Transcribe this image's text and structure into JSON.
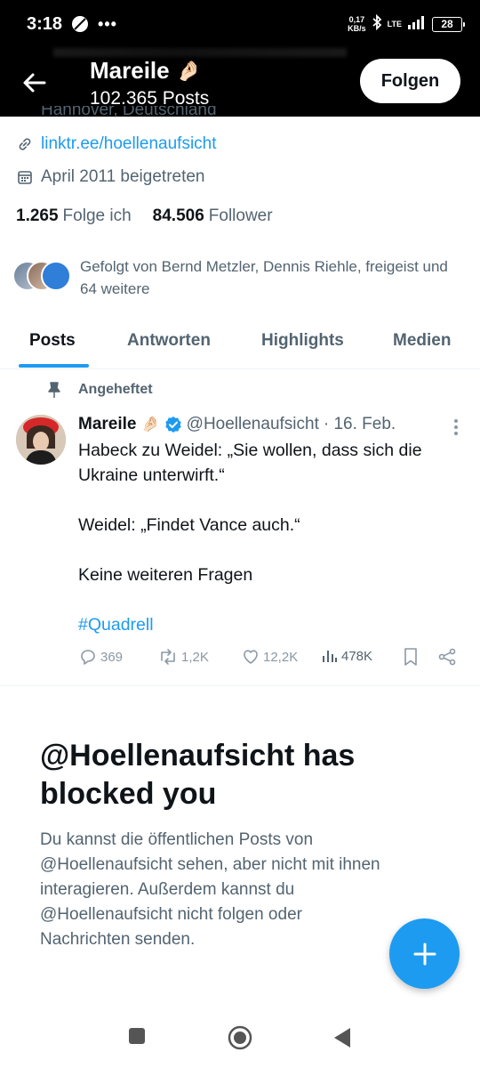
{
  "status_bar": {
    "time": "3:18",
    "dots": "•••",
    "speed_value": "0,17",
    "speed_unit": "KB/s",
    "network": "LTE",
    "battery": "28"
  },
  "profile_header": {
    "name": "Mareile",
    "name_emoji": "🤌🏻",
    "post_count": "102.365 Posts",
    "follow_label": "Folgen"
  },
  "profile": {
    "location": "Hannover, Deutschland",
    "link": "linktr.ee/hoellenaufsicht",
    "joined": "April 2011 beigetreten",
    "following_count": "1.265",
    "following_label": "Folge ich",
    "followers_count": "84.506",
    "followers_label": "Follower",
    "followed_by": "Gefolgt von Bernd Metzler, Dennis Riehle, freigeist und 64 weitere"
  },
  "tabs": [
    {
      "label": "Posts",
      "active": true
    },
    {
      "label": "Antworten",
      "active": false
    },
    {
      "label": "Highlights",
      "active": false
    },
    {
      "label": "Medien",
      "active": false
    }
  ],
  "pinned_tweet": {
    "pinned_label": "Angeheftet",
    "author": "Mareile",
    "author_emoji": "🤌🏻",
    "handle": "@Hoellenaufsicht",
    "date": "· 16. Feb.",
    "lines": [
      "Habeck zu Weidel: „Sie wollen, dass sich die Ukraine unterwirft.“",
      "Weidel: „Findet Vance auch.“",
      "Keine weiteren Fragen"
    ],
    "hashtag": "#Quadrell",
    "replies": "369",
    "reposts": "1,2K",
    "likes": "12,2K",
    "views": "478K"
  },
  "blocked": {
    "title": "@Hoellenaufsicht has blocked you",
    "description": "Du kannst die öffentlichen Posts von @Hoellenaufsicht sehen, aber nicht mit ihnen interagieren. Außerdem kannst du @Hoellenaufsicht nicht folgen oder Nachrichten senden."
  },
  "colors": {
    "accent": "#1d9bf0",
    "text": "#0f1419",
    "muted": "#536471",
    "header_bg": "#000000"
  },
  "icons": [
    "back-arrow-icon",
    "link-icon",
    "calendar-icon",
    "pin-icon",
    "verified-icon",
    "reply-icon",
    "repost-icon",
    "like-icon",
    "views-icon",
    "bookmark-icon",
    "share-icon",
    "compose-icon"
  ]
}
